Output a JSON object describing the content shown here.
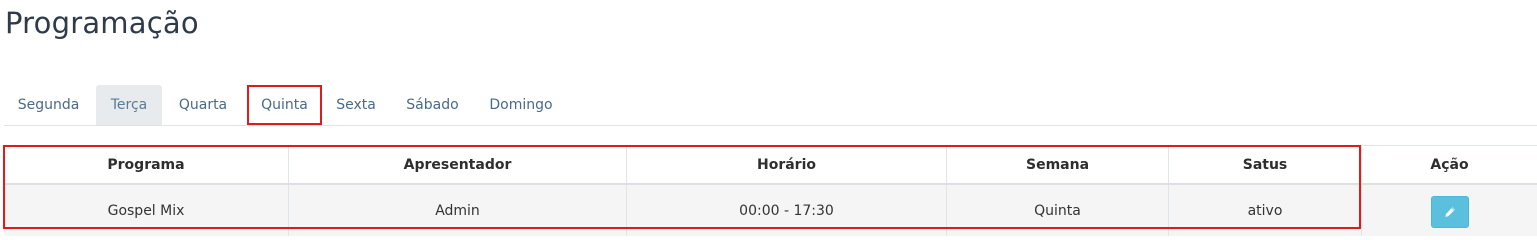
{
  "page": {
    "title": "Programação"
  },
  "tabs": [
    {
      "label": "Segunda",
      "active": false
    },
    {
      "label": "Terça",
      "active": true
    },
    {
      "label": "Quarta",
      "active": false
    },
    {
      "label": "Quinta",
      "active": false,
      "highlighted": true
    },
    {
      "label": "Sexta",
      "active": false
    },
    {
      "label": "Sábado",
      "active": false
    },
    {
      "label": "Domingo",
      "active": false
    }
  ],
  "table": {
    "columns": [
      "Programa",
      "Apresentador",
      "Horário",
      "Semana",
      "Satus",
      "Ação"
    ],
    "rows": [
      {
        "programa": "Gospel Mix",
        "apresentador": "Admin",
        "horario": "00:00 - 17:30",
        "semana": "Quinta",
        "status": "ativo",
        "action_icon": "pencil-icon"
      }
    ]
  },
  "colors": {
    "title": "#2f3b4a",
    "tab_text": "#4a6a8a",
    "tab_active_bg": "#e8ebee",
    "highlight": "#e01b1b",
    "row_bg": "#f5f5f5",
    "edit_button": "#5bc0de"
  }
}
